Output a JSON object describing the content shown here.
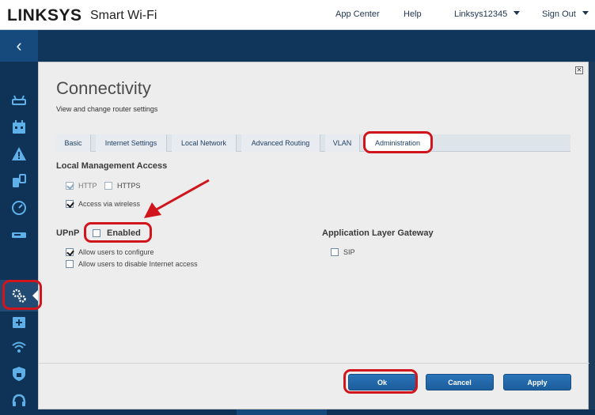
{
  "brand": {
    "name": "LINKSYS",
    "sub": "Smart Wi-Fi"
  },
  "topnav": {
    "app_center": "App Center",
    "help": "Help",
    "router": "Linksys12345",
    "sign_out": "Sign Out"
  },
  "page": {
    "title": "Connectivity",
    "subtitle": "View and change router settings"
  },
  "tabs": [
    "Basic",
    "Internet Settings",
    "Local Network",
    "Advanced Routing",
    "VLAN",
    "Administration"
  ],
  "active_tab": "Administration",
  "local_management": {
    "heading": "Local Management Access",
    "http_label": "HTTP",
    "http_checked": true,
    "https_label": "HTTPS",
    "https_checked": false,
    "wireless_label": "Access via wireless",
    "wireless_checked": true
  },
  "upnp": {
    "heading": "UPnP",
    "enabled_label": "Enabled",
    "enabled_checked": false,
    "allow_configure_label": "Allow users to configure",
    "allow_configure_checked": true,
    "allow_disable_label": "Allow users to disable Internet access",
    "allow_disable_checked": false
  },
  "alg": {
    "heading": "Application Layer Gateway",
    "sip_label": "SIP",
    "sip_checked": false
  },
  "buttons": {
    "ok": "Ok",
    "cancel": "Cancel",
    "apply": "Apply"
  },
  "colors": {
    "accent": "#1d5d9c",
    "sidebar": "#0f3357",
    "highlight": "#d0161c",
    "icon": "#5fb0e8"
  },
  "sidebar_icons": [
    "router-icon",
    "calendar-icon",
    "warning-icon",
    "devices-icon",
    "speed-icon",
    "storage-icon",
    "gears-icon",
    "health-icon",
    "wifi-icon",
    "security-icon",
    "headset-icon"
  ]
}
